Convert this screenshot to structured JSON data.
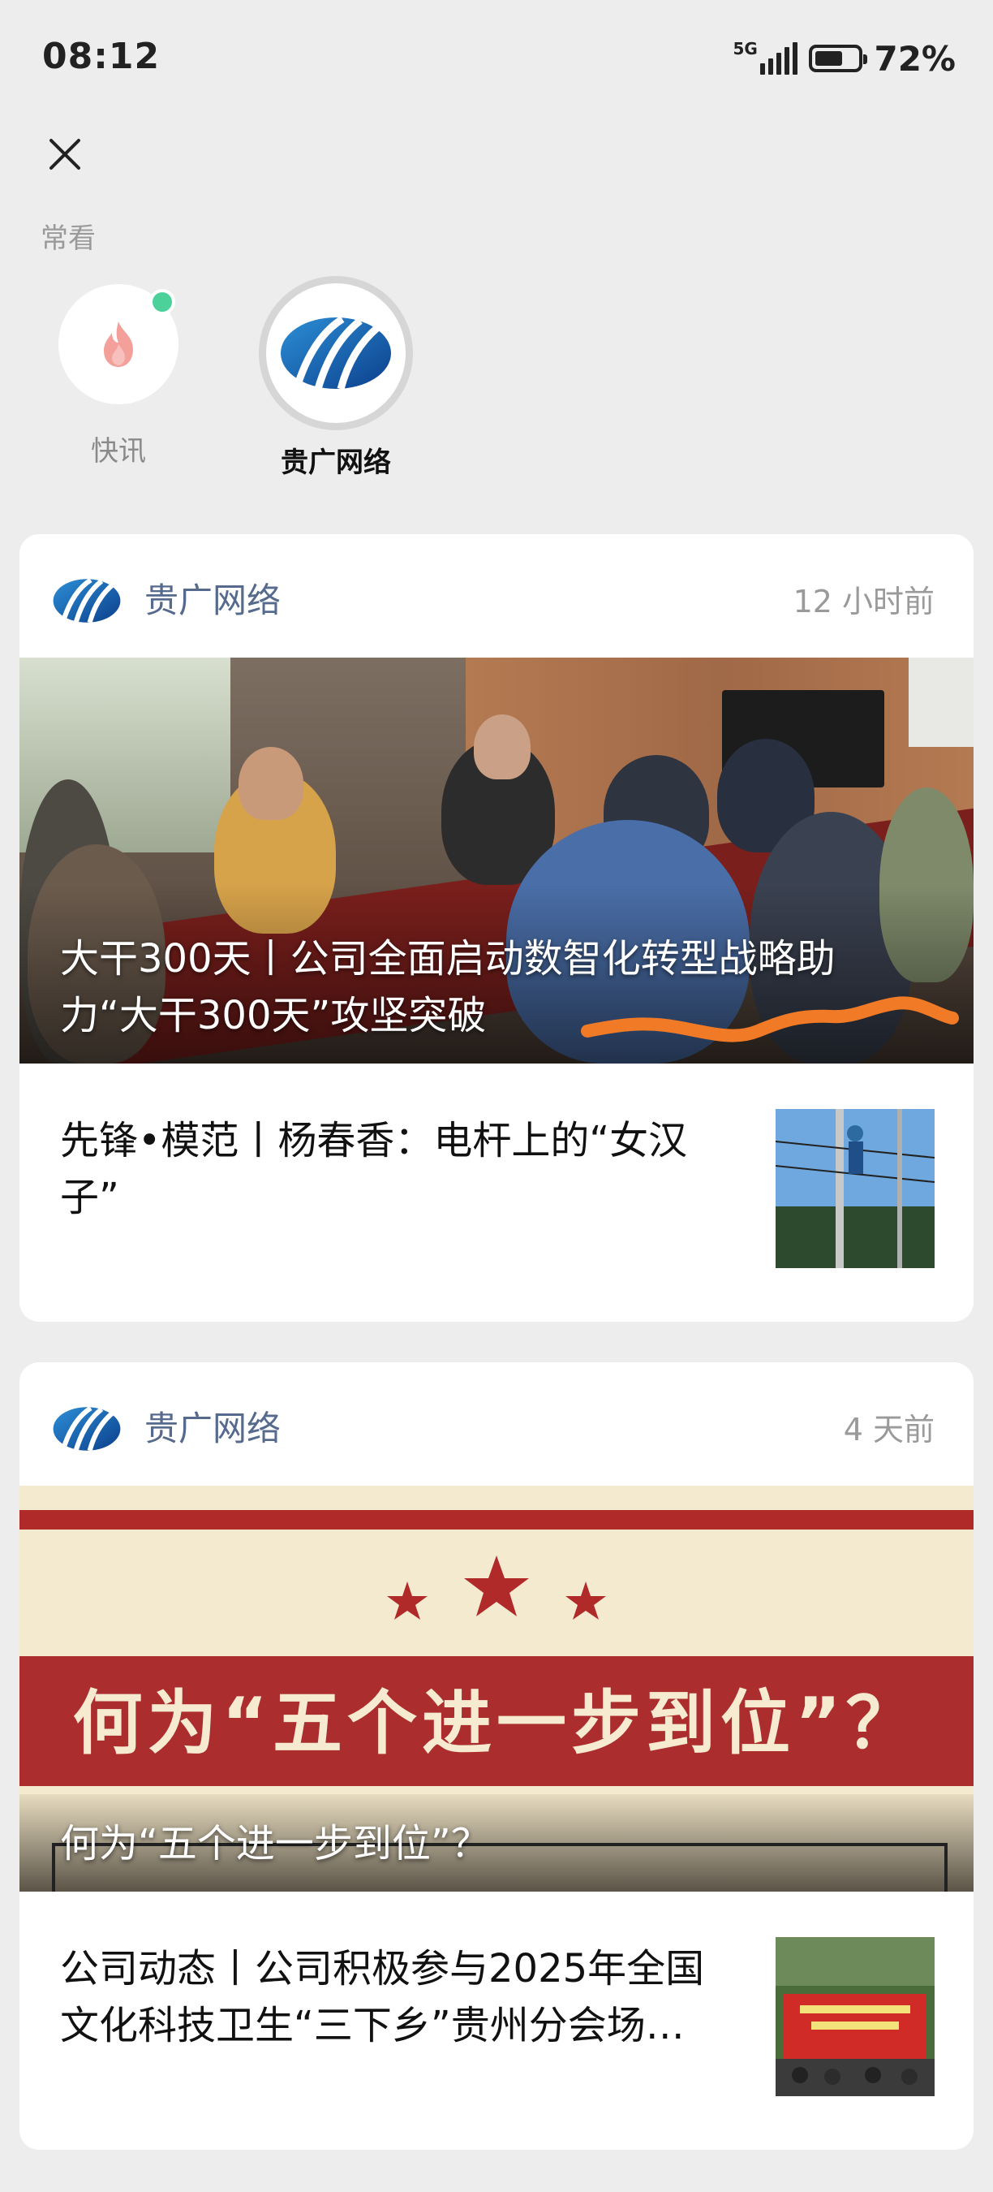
{
  "status_bar": {
    "time": "08:12",
    "network": "5G",
    "battery_level": 0.72,
    "battery_percent": "72%"
  },
  "frequent": {
    "label": "常看",
    "items": [
      {
        "name": "快讯",
        "icon": "flame-icon",
        "has_unread": true
      },
      {
        "name": "贵广网络",
        "icon": "guiguang-logo",
        "selected": true
      }
    ]
  },
  "cards": [
    {
      "source": "贵广网络",
      "time": "12 小时前",
      "hero_title": "大干300天丨公司全面启动数智化转型战略助力“大干300天”攻坚突破",
      "sub_title": "先锋•模范丨杨春香：电杆上的“女汉子”"
    },
    {
      "source": "贵广网络",
      "time": "4 天前",
      "hero_banner_text": "何为“五个进一步到位”？",
      "hero_title": "何为“五个进一步到位”？",
      "sub_title": "公司动态丨公司积极参与2025年全国文化科技卫生“三下乡”贵州分会场…"
    }
  ],
  "colors": {
    "background": "#ededed",
    "source_text": "#556a8c",
    "unread_dot": "#4dd19a",
    "banner_red": "#ab2d2d",
    "scribble": "#f07a26"
  }
}
